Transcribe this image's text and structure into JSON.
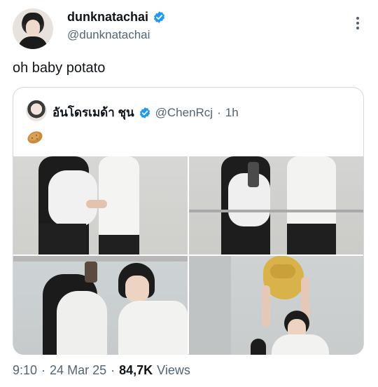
{
  "tweet": {
    "display_name": "dunknatachai",
    "handle": "@dunknatachai",
    "text": "oh baby potato",
    "verified_icon": "verified-badge-icon",
    "more_icon": "more-options-icon"
  },
  "quote": {
    "display_name": "อันโดรเมด้า ชุน",
    "handle": "@ChenRcj",
    "separator": "·",
    "time": "1h",
    "emoji": "potato-icon"
  },
  "footer": {
    "time": "9:10",
    "separator1": "·",
    "date": "24 Mar 25",
    "separator2": "·",
    "views_count": "84,7K",
    "views_label": "Views"
  },
  "colors": {
    "verified": "#1d9bf0",
    "secondary_text": "#536471",
    "border": "#cfd9de"
  }
}
